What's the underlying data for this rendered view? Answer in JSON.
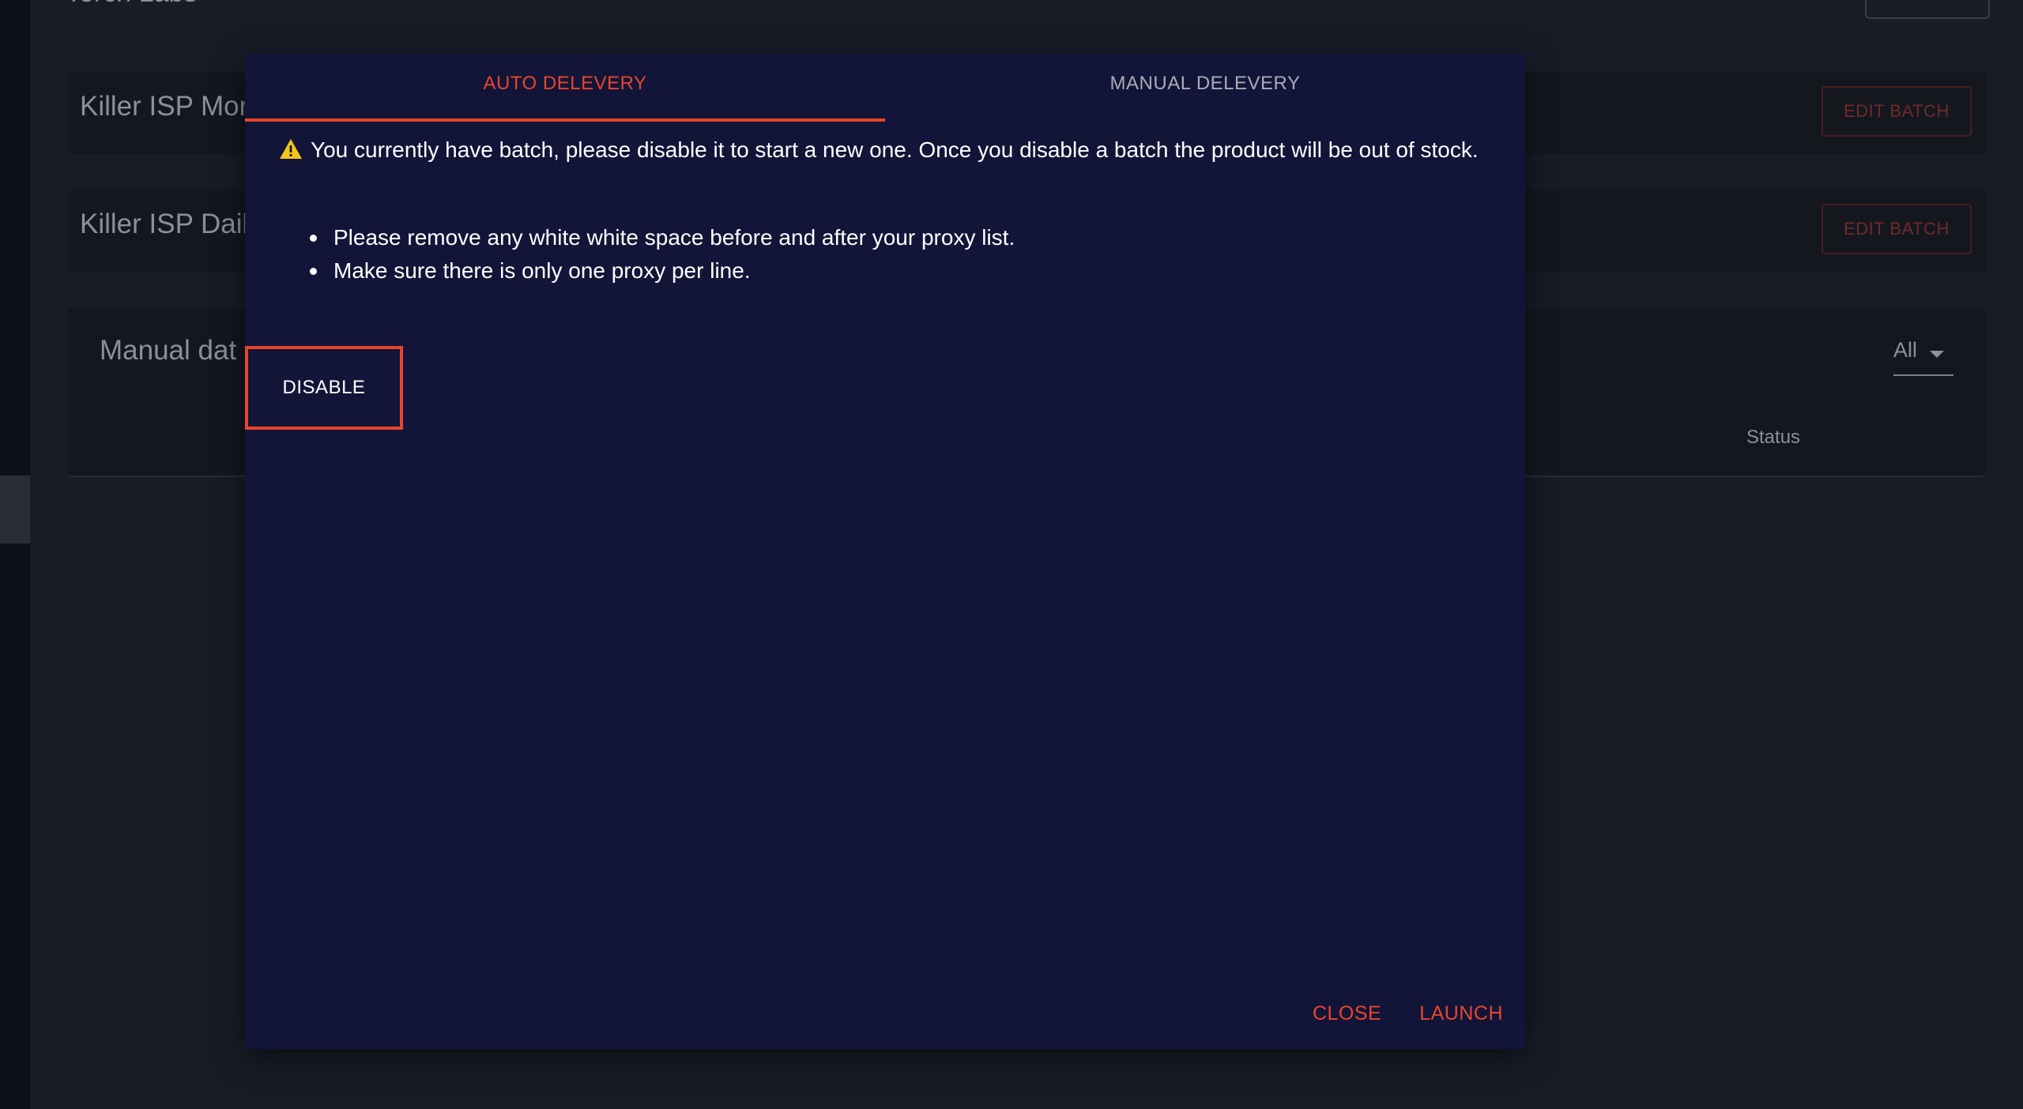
{
  "background": {
    "page_title": "Torch Labs",
    "products": [
      {
        "name": "Killer ISP Mor",
        "edit_label": "EDIT BATCH"
      },
      {
        "name": "Killer ISP Dail",
        "edit_label": "EDIT BATCH"
      }
    ],
    "table": {
      "title": "Manual dat",
      "filter_value": "All",
      "columns": {
        "status": "Status"
      }
    }
  },
  "dialog": {
    "tabs": [
      {
        "label": "AUTO DELEVERY",
        "active": true
      },
      {
        "label": "MANUAL DELEVERY",
        "active": false
      }
    ],
    "alert_text": "You currently have batch, please disable it to start a new one. Once you disable a batch the product will be out of stock.",
    "instructions": [
      "Please remove any white white space before and after your proxy list.",
      "Make sure there is only one proxy per line."
    ],
    "disable_label": "DISABLE",
    "close_label": "CLOSE",
    "launch_label": "LAUNCH"
  },
  "colors": {
    "accent": "#e8452e",
    "dialog_bg": "#121538",
    "warning": "#f5c518"
  },
  "icons": {
    "alert": "warning-icon",
    "filter": "chevron-down-icon"
  }
}
